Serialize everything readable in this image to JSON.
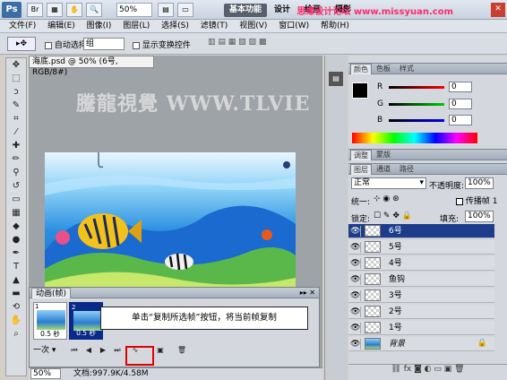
{
  "app": {
    "logo": "Ps",
    "zoom": "50%",
    "workspace_basic": "基本功能",
    "workspace_design": "设计",
    "workspace_paint": "绘画",
    "workspace_photo": "摄影"
  },
  "watermark_top": "思缘设计论坛 www.missyuan.com",
  "menu": [
    "文件(F)",
    "编辑(E)",
    "图像(I)",
    "图层(L)",
    "选择(S)",
    "滤镜(T)",
    "视图(V)",
    "窗口(W)",
    "帮助(H)"
  ],
  "options": {
    "auto_select": "自动选择:",
    "auto_select_value": "组",
    "show_transform": "显示变换控件"
  },
  "document": {
    "tab_title": "海底.psd @ 50% (6号, RGB/8#)",
    "watermark": "騰龍視覺 WWW.TLVIE",
    "zoom": "50%",
    "doc_size": "文档:997.9K/4.58M"
  },
  "animation": {
    "tab": "动画(帧)",
    "frames": [
      {
        "number": "1",
        "delay": "0.5 秒"
      },
      {
        "number": "2",
        "delay": "0.5 秒"
      }
    ],
    "loop": "一次",
    "callout": "单击“复制所选帧”按钮，将当前帧复制"
  },
  "panels": {
    "color_tabs": [
      "颜色",
      "色板",
      "样式"
    ],
    "color_values": {
      "R": "0",
      "G": "0",
      "B": "0"
    },
    "adjust_tabs": [
      "调整",
      "蒙版"
    ],
    "layer_tabs": [
      "图层",
      "通道",
      "路径"
    ],
    "blend_mode": "正常",
    "opacity_label": "不透明度:",
    "opacity": "100%",
    "unify_label": "统一:",
    "propagate_label": "传播帧 1",
    "lock_label": "锁定:",
    "fill_label": "填充:",
    "fill": "100%",
    "layers": [
      {
        "name": "6号",
        "active": true
      },
      {
        "name": "5号",
        "active": false
      },
      {
        "name": "4号",
        "active": false
      },
      {
        "name": "鱼钩",
        "active": false
      },
      {
        "name": "3号",
        "active": false
      },
      {
        "name": "2号",
        "active": false
      },
      {
        "name": "1号",
        "active": false
      },
      {
        "name": "背景",
        "active": false
      }
    ]
  }
}
